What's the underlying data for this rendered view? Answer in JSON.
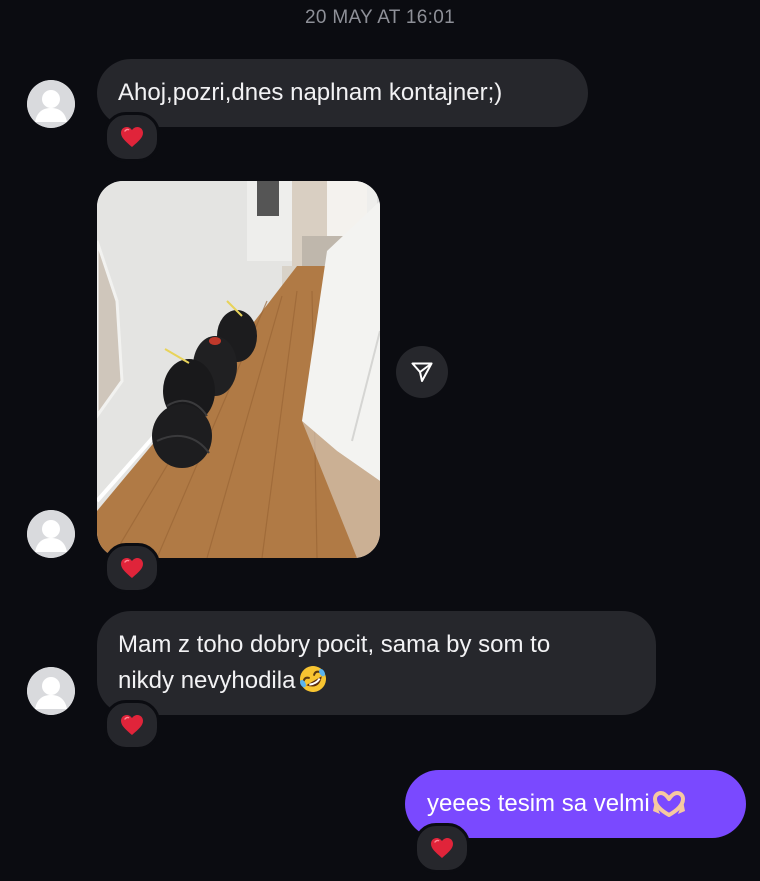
{
  "thread": {
    "timestamp": "20 MAY AT 16:01"
  },
  "messages": [
    {
      "sender": "other",
      "type": "text",
      "text": "Ahoj,pozri,dnes naplnam kontajner;)",
      "reaction": "heart"
    },
    {
      "sender": "other",
      "type": "image",
      "image_description": "Hallway with wooden floor and black garbage bags",
      "reaction": "heart"
    },
    {
      "sender": "other",
      "type": "text",
      "line1": "Mam z toho dobry pocit, sama by som to",
      "line2": "nikdy nevyhodila",
      "trailing_emoji": "rolling-on-floor-laughing-emoji",
      "reaction": "heart"
    },
    {
      "sender": "me",
      "type": "text",
      "text": "yeees tesim sa velmi",
      "trailing_emoji": "heart-hands-emoji",
      "reaction": "heart"
    }
  ],
  "icons": {
    "reaction": "heart-icon",
    "share": "send-paper-plane-icon",
    "avatar": "default-user-avatar-icon"
  },
  "colors": {
    "background": "#0b0c11",
    "incoming_bubble": "#26272c",
    "outgoing_bubble": "#7a49ff",
    "heart": "#e0243a",
    "timestamp": "#8e9098"
  }
}
